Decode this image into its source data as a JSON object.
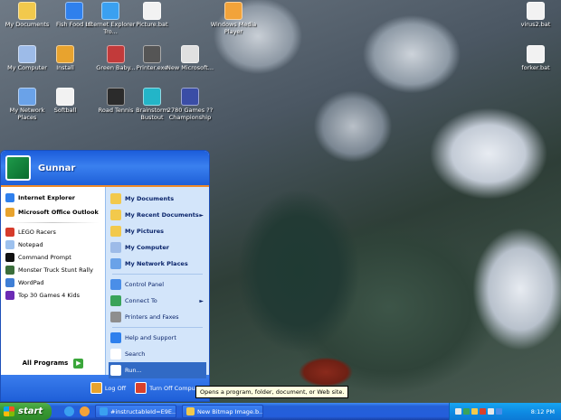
{
  "desktop": {
    "icons": [
      {
        "label": "My Documents",
        "color": "#f2c94c"
      },
      {
        "label": "Fish Food LE",
        "color": "#2f80ed"
      },
      {
        "label": "Internet Explorer Tro...",
        "color": "#3aa0f0"
      },
      {
        "label": "Picture.bat",
        "color": "#f2f2f2"
      },
      {
        "label": "Windows Media Player",
        "color": "#f2a33a"
      },
      {
        "label": "virus2.bat",
        "color": "#f2f2f2"
      },
      {
        "label": "My Computer",
        "color": "#9dbbe8"
      },
      {
        "label": "Install",
        "color": "#e8a32e"
      },
      {
        "label": "Green Baby...",
        "color": "#c23a3a"
      },
      {
        "label": "Printer.exe",
        "color": "#555555"
      },
      {
        "label": "New Microsoft...",
        "color": "#e0e0e0"
      },
      {
        "label": "forker.bat",
        "color": "#f2f2f2"
      },
      {
        "label": "My Network Places",
        "color": "#6aa2e8"
      },
      {
        "label": "Softball",
        "color": "#f2f2f2"
      },
      {
        "label": "Road Tennis",
        "color": "#2b2b2b"
      },
      {
        "label": "Brainstorm Bustout",
        "color": "#23b5c8"
      },
      {
        "label": "2780 Games ?? Championship",
        "color": "#3a4da6"
      }
    ]
  },
  "start_menu": {
    "user_name": "Gunnar",
    "pinned": [
      {
        "label": "Internet Explorer",
        "color": "#2f80ed"
      },
      {
        "label": "Microsoft Office Outlook",
        "color": "#e8a32e"
      }
    ],
    "recent": [
      {
        "label": "LEGO Racers",
        "color": "#d63b2b"
      },
      {
        "label": "Notepad",
        "color": "#9dc1ee"
      },
      {
        "label": "Command Prompt",
        "color": "#111111"
      },
      {
        "label": "Monster Truck Stunt Rally",
        "color": "#3b6e3b"
      },
      {
        "label": "WordPad",
        "color": "#3f7fd6"
      },
      {
        "label": "Top 30 Games 4 Kids",
        "color": "#6c2bb5"
      }
    ],
    "all_programs_label": "All Programs",
    "places": [
      {
        "label": "My Documents",
        "color": "#f2c94c",
        "arrow": ""
      },
      {
        "label": "My Recent Documents",
        "color": "#f2c94c",
        "arrow": "►"
      },
      {
        "label": "My Pictures",
        "color": "#f2c94c",
        "arrow": ""
      },
      {
        "label": "My Computer",
        "color": "#9dbbe8",
        "arrow": ""
      },
      {
        "label": "My Network Places",
        "color": "#6aa2e8",
        "arrow": ""
      }
    ],
    "system": [
      {
        "label": "Control Panel",
        "color": "#4a8ee8",
        "arrow": ""
      },
      {
        "label": "Connect To",
        "color": "#3aa35a",
        "arrow": "►"
      },
      {
        "label": "Printers and Faxes",
        "color": "#8e8e8e",
        "arrow": ""
      }
    ],
    "help": [
      {
        "label": "Help and Support",
        "color": "#2f80ed",
        "arrow": ""
      },
      {
        "label": "Search",
        "color": "#ffffff",
        "arrow": ""
      },
      {
        "label": "Run...",
        "color": "#ffffff",
        "arrow": ""
      }
    ],
    "log_off_label": "Log Off",
    "turn_off_label": "Turn Off Computer"
  },
  "tooltip": {
    "text": "Opens a program, folder, document, or Web site."
  },
  "taskbar": {
    "start_label": "start",
    "tasks": [
      {
        "label": "#instructableId=E9E...",
        "color": "#3aa0f0"
      },
      {
        "label": "New Bitmap Image.b...",
        "color": "#f2c94c"
      }
    ],
    "clock": "8:12 PM"
  },
  "colors": {
    "xp_blue": "#245edb",
    "start_green": "#3a9a34",
    "highlight": "#316ac5"
  }
}
